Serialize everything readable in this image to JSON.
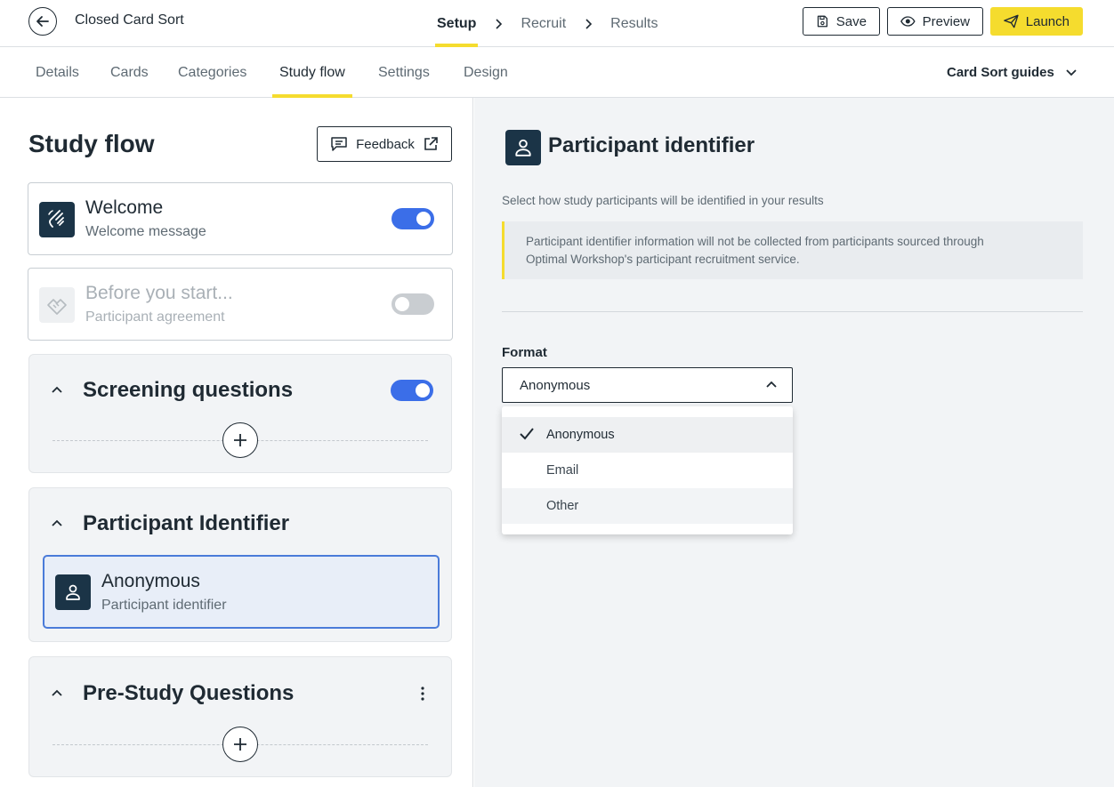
{
  "header": {
    "title": "Closed Card Sort",
    "steps": [
      "Setup",
      "Recruit",
      "Results"
    ],
    "active_step": "Setup",
    "save_label": "Save",
    "preview_label": "Preview",
    "launch_label": "Launch",
    "accent_color": "#f5dc2e"
  },
  "subtabs": {
    "items": [
      "Details",
      "Cards",
      "Categories",
      "Study flow",
      "Settings",
      "Design"
    ],
    "active": "Study flow",
    "guides_label": "Card Sort guides"
  },
  "left": {
    "title": "Study flow",
    "feedback_label": "Feedback",
    "welcome": {
      "title": "Welcome",
      "subtitle": "Welcome message",
      "enabled": true
    },
    "before_start": {
      "title": "Before you start...",
      "subtitle": "Participant agreement",
      "enabled": false
    },
    "screening": {
      "title": "Screening questions",
      "enabled": true
    },
    "participant_identifier": {
      "title": "Participant Identifier",
      "card_title": "Anonymous",
      "card_subtitle": "Participant identifier"
    },
    "pre_study": {
      "title": "Pre-Study Questions"
    }
  },
  "right": {
    "title": "Participant identifier",
    "description": "Select how study participants will be identified in your results",
    "notice_line1": "Participant identifier information will not be collected from participants sourced through",
    "notice_line2": "Optimal Workshop's participant recruitment service.",
    "format_label": "Format",
    "format_value": "Anonymous",
    "options": [
      "Anonymous",
      "Email",
      "Other"
    ],
    "selected_option": "Anonymous"
  },
  "colors": {
    "toggle_on": "#3b6ee8",
    "icon_bg": "#1b3447",
    "selected_border": "#4a7bd9"
  }
}
